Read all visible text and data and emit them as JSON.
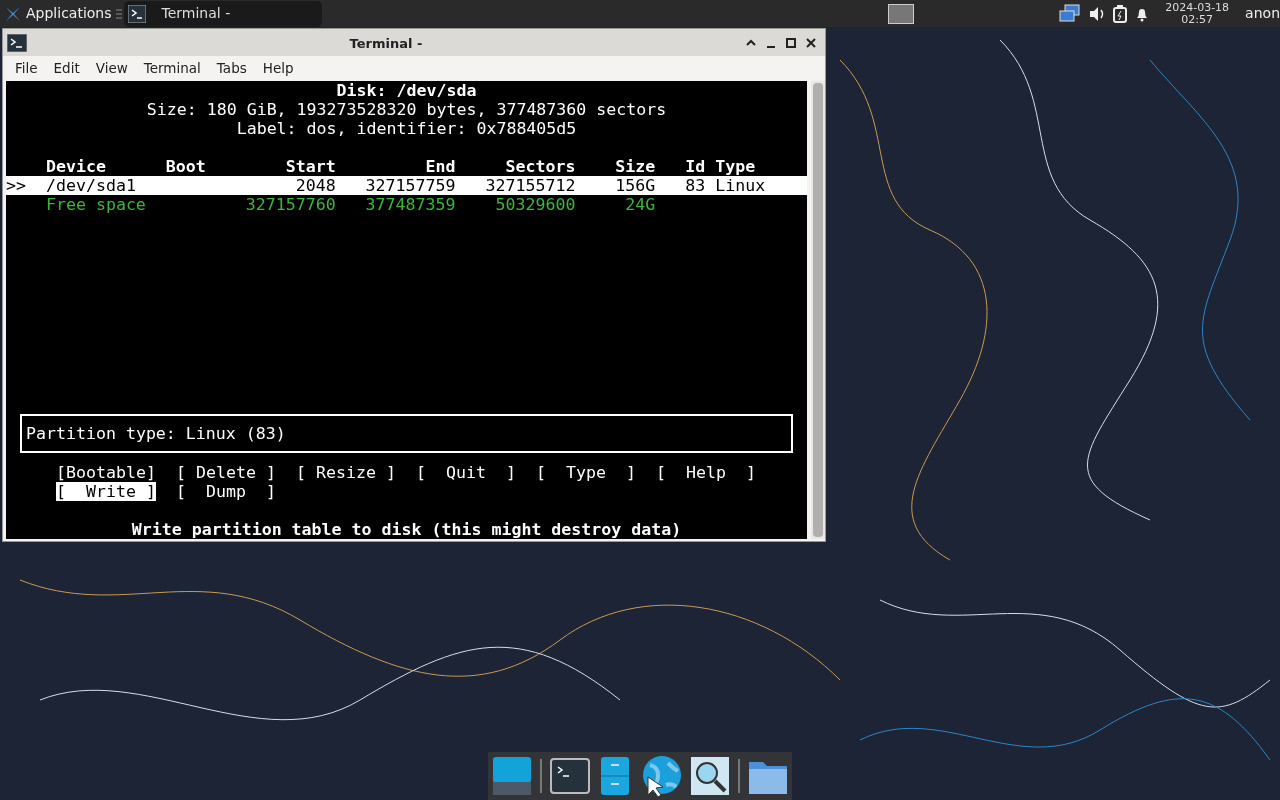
{
  "panel": {
    "app_menu": "Applications",
    "tasks": [
      {
        "title": "Terminal -",
        "selected": true
      }
    ],
    "clock": {
      "date": "2024-03-18",
      "time": "02:57"
    },
    "user": "anon"
  },
  "window": {
    "title": "Terminal -",
    "menu": [
      "File",
      "Edit",
      "View",
      "Terminal",
      "Tabs",
      "Help"
    ],
    "terminal": {
      "header": [
        "Disk: /dev/sda",
        "Size: 180 GiB, 193273528320 bytes, 377487360 sectors",
        "Label: dos, identifier: 0x788405d5"
      ],
      "columns": [
        "Device",
        "Boot",
        "Start",
        "End",
        "Sectors",
        "Size",
        "Id",
        "Type"
      ],
      "rows": [
        {
          "marker": ">>",
          "kind": "partition",
          "selected": true,
          "cells": [
            "/dev/sda1",
            "",
            "2048",
            "327157759",
            "327155712",
            "156G",
            "83",
            "Linux"
          ]
        },
        {
          "marker": "",
          "kind": "free",
          "selected": false,
          "cells": [
            "Free space",
            "",
            "327157760",
            "377487359",
            "50329600",
            "24G",
            "",
            ""
          ]
        }
      ],
      "info": "Partition type: Linux (83)",
      "actions": [
        {
          "label": "[Bootable]",
          "selected": false
        },
        {
          "label": "[ Delete ]",
          "selected": false
        },
        {
          "label": "[ Resize ]",
          "selected": false
        },
        {
          "label": "[  Quit  ]",
          "selected": false
        },
        {
          "label": "[  Type  ]",
          "selected": false
        },
        {
          "label": "[  Help  ]",
          "selected": false
        },
        {
          "label": "[  Write ]",
          "selected": true
        },
        {
          "label": "[  Dump  ]",
          "selected": false
        }
      ],
      "status": "Write partition table to disk (this might destroy data)"
    }
  }
}
